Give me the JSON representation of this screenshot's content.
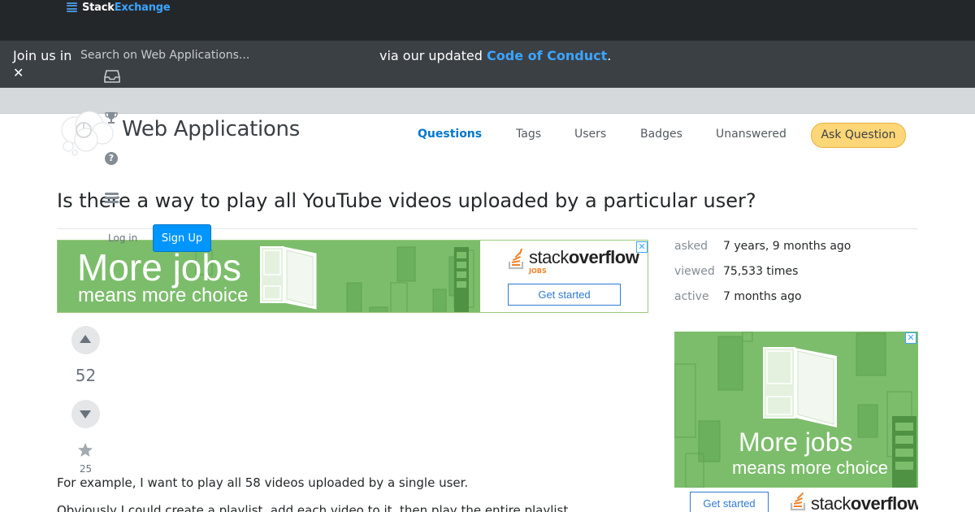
{
  "topbar": {
    "brand_stack": "Stack",
    "brand_exchange": "Exchange"
  },
  "notice": {
    "text_start": "Join us in",
    "text_end": "via our updated",
    "link": "Code of Conduct",
    "period": ".",
    "close_glyph": "✕"
  },
  "search": {
    "placeholder": "Search on Web Applications..."
  },
  "site": {
    "title": "Web Applications",
    "help_glyph": "?"
  },
  "nav": {
    "items": [
      "Questions",
      "Tags",
      "Users",
      "Badges",
      "Unanswered"
    ],
    "ask_button": "Ask Question"
  },
  "auth": {
    "login": "Log in",
    "signup": "Sign Up"
  },
  "question": {
    "title": "Is there a way to play all YouTube videos uploaded by a particular user?",
    "score": "52",
    "favorites": "25",
    "body": [
      "For example, I want to play all 58 videos uploaded by a single user.",
      "Obviously I could create a playlist, add each video to it, then play the entire playlist."
    ]
  },
  "stats": {
    "asked_label": "asked",
    "asked_value": "7 years, 9 months ago",
    "viewed_label": "viewed",
    "viewed_value": "75,533 times",
    "active_label": "active",
    "active_value": "7 months ago"
  },
  "ads": {
    "headline_1": "More jobs",
    "headline_2": "means more choice",
    "brand_stack": "stack",
    "brand_overflow": "overflow",
    "brand_sub": "JOBS",
    "cta": "Get started",
    "close_glyph": "✕"
  },
  "colors": {
    "topbar": "#242729",
    "notice_bg": "#3b4045",
    "link_blue": "#3ca4ff",
    "nav_active": "#0077cc",
    "ask_button": "#fdd677",
    "signup_button": "#0095ff",
    "ad_green": "#7cbd6b"
  }
}
